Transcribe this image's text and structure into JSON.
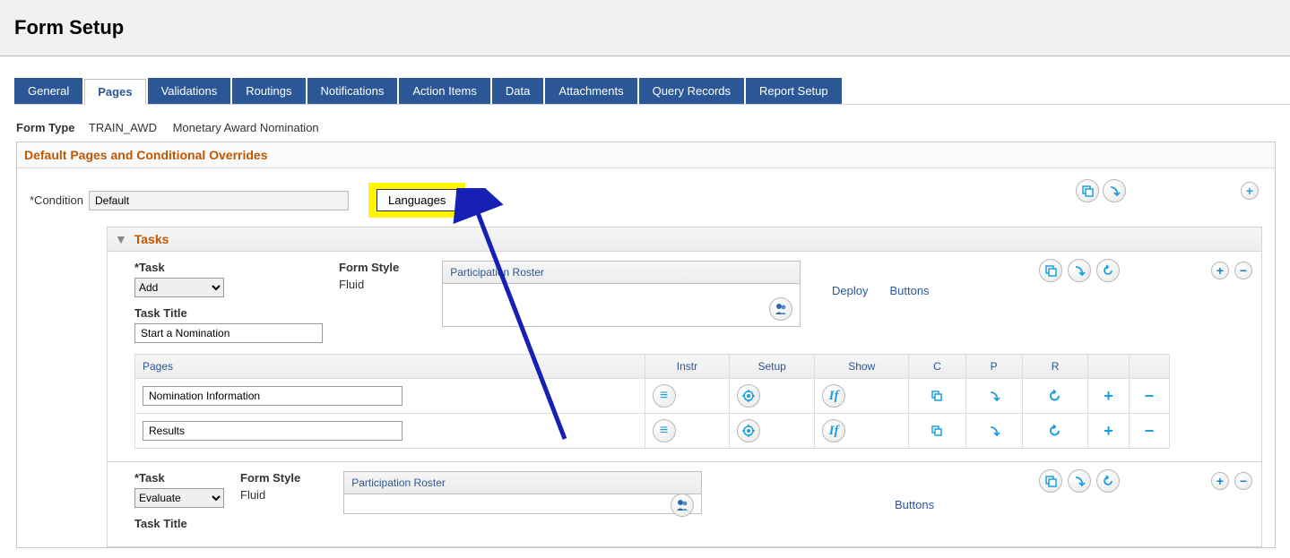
{
  "page": {
    "title": "Form Setup"
  },
  "tabs": {
    "items": [
      {
        "label": "General"
      },
      {
        "label": "Pages"
      },
      {
        "label": "Validations"
      },
      {
        "label": "Routings"
      },
      {
        "label": "Notifications"
      },
      {
        "label": "Action Items"
      },
      {
        "label": "Data"
      },
      {
        "label": "Attachments"
      },
      {
        "label": "Query Records"
      },
      {
        "label": "Report Setup"
      }
    ],
    "active_index": 1
  },
  "form_type": {
    "label": "Form Type",
    "code": "TRAIN_AWD",
    "name": "Monetary Award Nomination"
  },
  "section": {
    "title": "Default Pages and Conditional Overrides",
    "condition": {
      "label": "*Condition",
      "value": "Default"
    },
    "languages_button": "Languages"
  },
  "tasks": {
    "header": "Tasks",
    "items": [
      {
        "task_label": "*Task",
        "task_value": "Add",
        "form_style_label": "Form Style",
        "form_style_value": "Fluid",
        "task_title_label": "Task Title",
        "task_title_value": "Start a Nomination",
        "roster_title": "Participation Roster",
        "deploy": "Deploy",
        "buttons": "Buttons",
        "pages_rows": [
          {
            "name": "Nomination Information"
          },
          {
            "name": "Results"
          }
        ]
      },
      {
        "task_label": "*Task",
        "task_value": "Evaluate",
        "form_style_label": "Form Style",
        "form_style_value": "Fluid",
        "task_title_label": "Task Title",
        "task_title_value": "",
        "roster_title": "Participation Roster",
        "buttons": "Buttons"
      }
    ]
  },
  "pages_table": {
    "headers": {
      "pages": "Pages",
      "instr": "Instr",
      "setup": "Setup",
      "show": "Show",
      "c": "C",
      "p": "P",
      "r": "R"
    }
  },
  "icons": {
    "copy": "⧉",
    "paste": "⤷",
    "undo": "↺",
    "add": "+",
    "remove": "−",
    "menu": "≡",
    "target": "✦",
    "if": "If",
    "people": "👥"
  },
  "colors": {
    "brand": "#2b5797",
    "accent": "#bf5700",
    "highlight": "#fff600",
    "icon": "#1a9fe0"
  }
}
